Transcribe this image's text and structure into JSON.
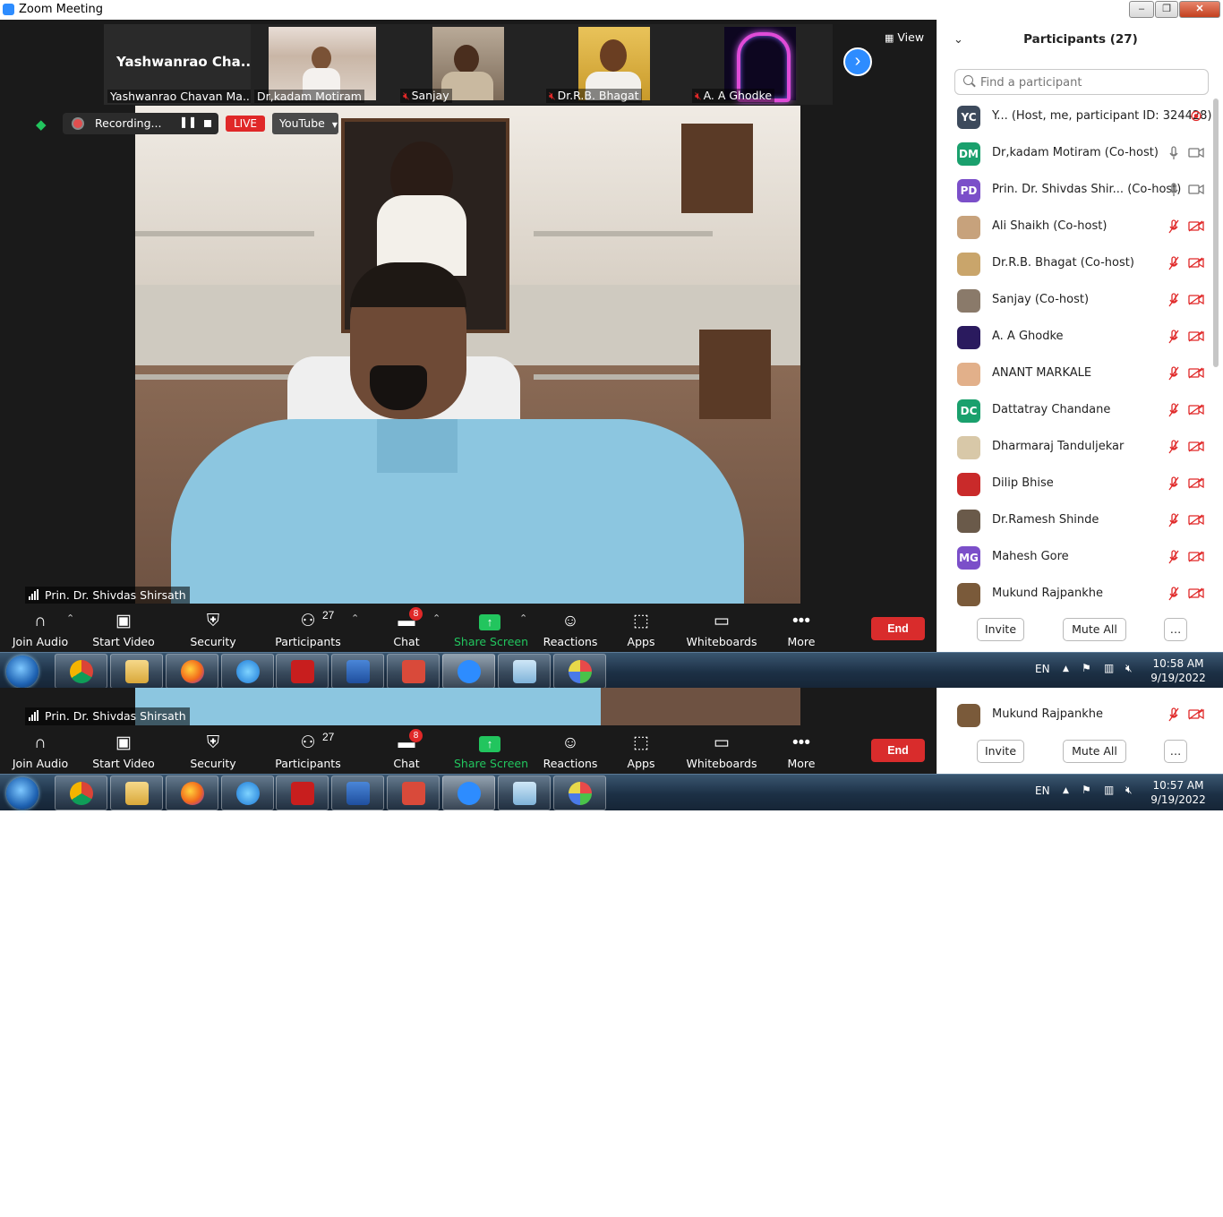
{
  "window": {
    "title": "Zoom Meeting",
    "minimize": "–",
    "restore": "❐",
    "close": "✕"
  },
  "thumbnails": [
    {
      "name": "Yashwanrao Chavan Ma...",
      "display": "Yashwanrao  Cha...",
      "muted": false
    },
    {
      "name": "Dr,kadam Motiram",
      "muted": false
    },
    {
      "name": "Sanjay",
      "muted": true
    },
    {
      "name": "Dr.R.B. Bhagat",
      "muted": true
    },
    {
      "name": "A. A Ghodke",
      "muted": true
    }
  ],
  "view_label": "View",
  "recording": {
    "label": "Recording...",
    "live": "LIVE",
    "stream": "YouTube"
  },
  "active_speaker": "Prin. Dr. Shivdas Shirsath",
  "toolbar": {
    "join_audio": "Join Audio",
    "start_video": "Start Video",
    "security": "Security",
    "participants": "Participants",
    "participants_count": "27",
    "chat": "Chat",
    "chat_badge": "8",
    "share_screen": "Share Screen",
    "reactions": "Reactions",
    "apps": "Apps",
    "whiteboards": "Whiteboards",
    "more": "More",
    "end": "End"
  },
  "panel": {
    "title": "Participants (27)",
    "search_placeholder": "Find a participant",
    "invite": "Invite",
    "mute_all": "Mute All",
    "more": "…"
  },
  "participants": [
    {
      "initials": "YC",
      "color": "#3d4a5c",
      "name": "Y...  (Host, me, participant ID: 324428)",
      "status": "recording"
    },
    {
      "initials": "DM",
      "color": "#1aa06d",
      "name": "Dr,kadam Motiram (Co-host)",
      "status": "on"
    },
    {
      "initials": "PD",
      "color": "#7b4fc9",
      "name": "Prin. Dr. Shivdas Shir...  (Co-host)",
      "status": "on"
    },
    {
      "initials": "",
      "color": "#c7a27c",
      "name": "Ali Shaikh (Co-host)",
      "status": "off"
    },
    {
      "initials": "",
      "color": "#c9a56b",
      "name": "Dr.R.B. Bhagat (Co-host)",
      "status": "off"
    },
    {
      "initials": "",
      "color": "#8a7a6a",
      "name": "Sanjay (Co-host)",
      "status": "off"
    },
    {
      "initials": "",
      "color": "#2a1a5e",
      "name": "A. A Ghodke",
      "status": "off"
    },
    {
      "initials": "",
      "color": "#e2b08a",
      "name": "ANANT MARKALE",
      "status": "off"
    },
    {
      "initials": "DC",
      "color": "#1aa06d",
      "name": "Dattatray Chandane",
      "status": "off"
    },
    {
      "initials": "",
      "color": "#d8c8a8",
      "name": "Dharmaraj Tanduljekar",
      "status": "off"
    },
    {
      "initials": "",
      "color": "#c92a2a",
      "name": "Dilip Bhise",
      "status": "off"
    },
    {
      "initials": "",
      "color": "#6a5a4a",
      "name": "Dr.Ramesh Shinde",
      "status": "off"
    },
    {
      "initials": "MG",
      "color": "#7b4fc9",
      "name": "Mahesh Gore",
      "status": "off"
    },
    {
      "initials": "",
      "color": "#7a5a3a",
      "name": "Mukund Rajpankhe",
      "status": "off"
    }
  ],
  "taskbar": {
    "lang": "EN",
    "time": "10:58 AM",
    "date": "9/19/2022"
  },
  "lower": {
    "speaker": "Prin. Dr. Shivdas Shirsath",
    "participant": "Mukund Rajpankhe",
    "time": "10:57 AM",
    "date": "9/19/2022",
    "lang": "EN"
  }
}
